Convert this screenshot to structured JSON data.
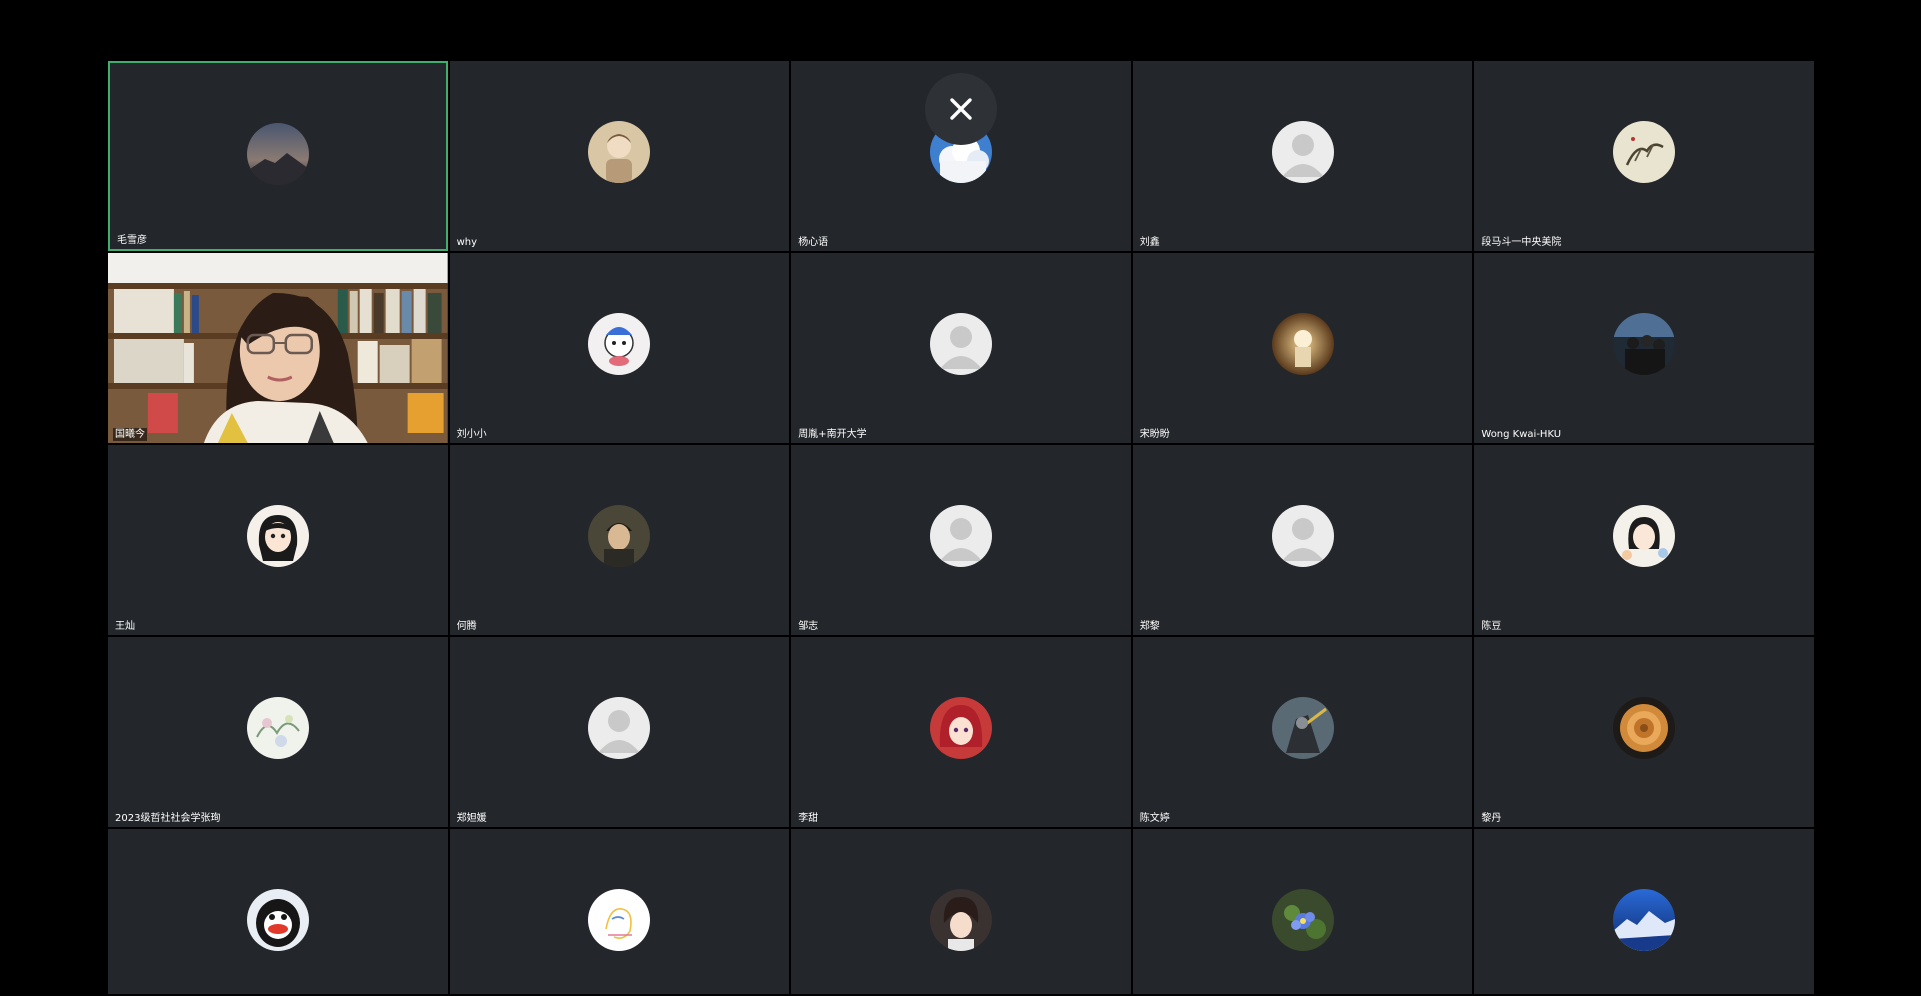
{
  "colors": {
    "page_background": "#000000",
    "tile_background": "#23262a",
    "active_speaker_border": "#3fae6f",
    "name_text": "#ffffff"
  },
  "controls": {
    "close_icon": "close-icon"
  },
  "participants": [
    {
      "name": "毛雪彦",
      "avatar": "mountain-photo",
      "active": true
    },
    {
      "name": "why",
      "avatar": "child-portrait"
    },
    {
      "name": "杨心语",
      "avatar": "sky-clouds"
    },
    {
      "name": "刘鑫",
      "avatar": "default-person-icon"
    },
    {
      "name": "段马斗一中央美院",
      "avatar": "ink-painting"
    },
    {
      "name": "国曦今",
      "avatar": "live-video"
    },
    {
      "name": "刘小小",
      "avatar": "cartoon-character"
    },
    {
      "name": "周胤+南开大学",
      "avatar": "default-person-icon"
    },
    {
      "name": "宋盼盼",
      "avatar": "warm-photo"
    },
    {
      "name": "Wong Kwai-HKU",
      "avatar": "group-photo"
    },
    {
      "name": "王灿",
      "avatar": "anime-girl"
    },
    {
      "name": "何腾",
      "avatar": "boy-portrait"
    },
    {
      "name": "邹志",
      "avatar": "default-person-icon"
    },
    {
      "name": "郑黎",
      "avatar": "default-person-icon"
    },
    {
      "name": "陈豆",
      "avatar": "illustrated-girl"
    },
    {
      "name": "2023级哲社社会学张珣",
      "avatar": "floral-sketch"
    },
    {
      "name": "郑妲媛",
      "avatar": "default-person-icon"
    },
    {
      "name": "李甜",
      "avatar": "red-hair-anime"
    },
    {
      "name": "陈文婷",
      "avatar": "knight-artwork"
    },
    {
      "name": "黎丹",
      "avatar": "bread-pastry"
    },
    {
      "name": "",
      "avatar": "penguin-cartoon"
    },
    {
      "name": "",
      "avatar": "line-sketch"
    },
    {
      "name": "",
      "avatar": "anime-boy"
    },
    {
      "name": "",
      "avatar": "blue-flower"
    },
    {
      "name": "",
      "avatar": "blue-landscape"
    }
  ]
}
